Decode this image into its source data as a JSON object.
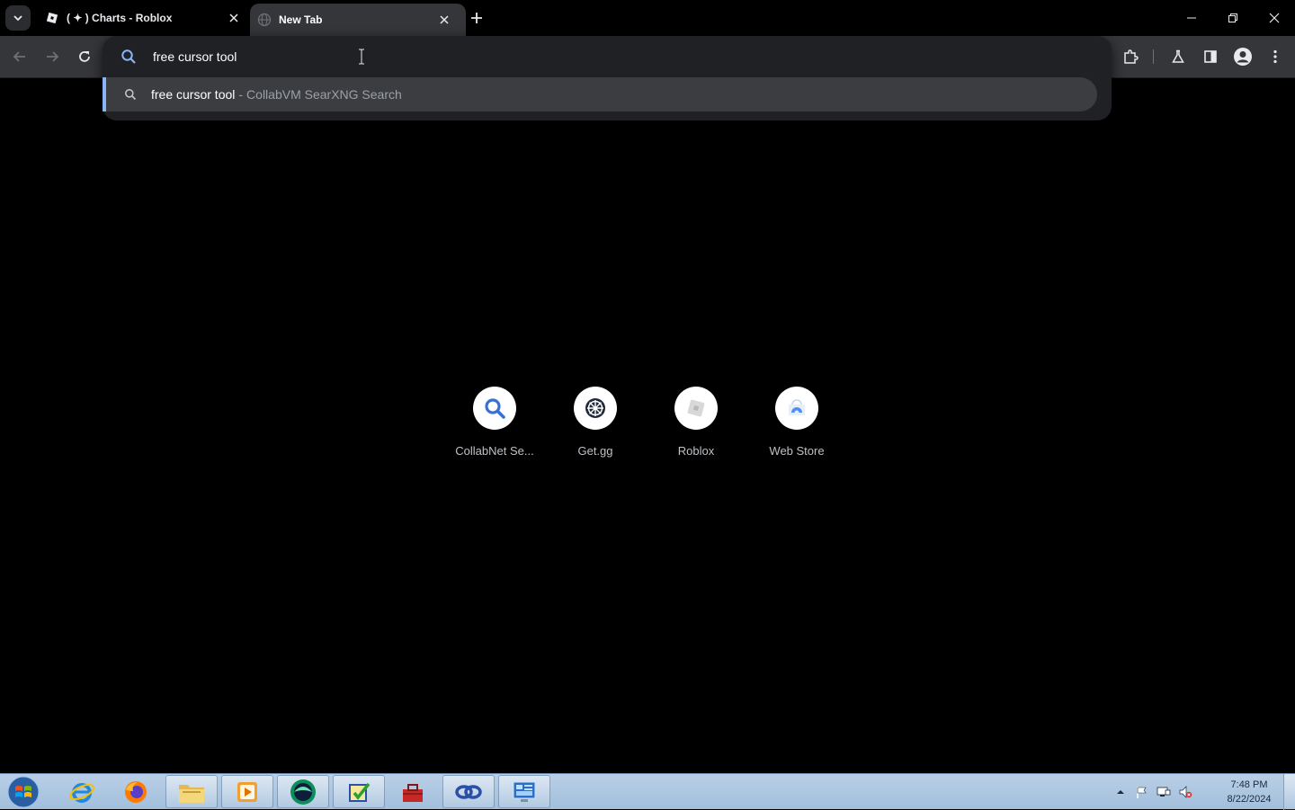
{
  "browser": {
    "tabs": [
      {
        "title": "( ✦ ) Charts - Roblox",
        "active": false
      },
      {
        "title": "New Tab",
        "active": true
      }
    ],
    "omnibox": {
      "value": "free cursor tool",
      "suggestion": {
        "query": "free cursor tool",
        "separator": "-",
        "engine": "CollabVM SearXNG Search"
      }
    },
    "accent_color": "#8ab4f8"
  },
  "shortcuts": [
    {
      "label": "CollabNet Se...",
      "icon": "search-icon"
    },
    {
      "label": "Get.gg",
      "icon": "wheel-icon"
    },
    {
      "label": "Roblox",
      "icon": "roblox-icon"
    },
    {
      "label": "Web Store",
      "icon": "web-store-icon"
    }
  ],
  "taskbar": {
    "apps": [
      "internet-explorer-icon",
      "firefox-icon",
      "file-explorer-icon",
      "media-player-icon",
      "app-green-icon",
      "task-icon",
      "toolbox-icon",
      "app-blue-icon",
      "control-panel-icon"
    ],
    "clock": {
      "time": "7:48 PM",
      "date": "8/22/2024"
    }
  }
}
